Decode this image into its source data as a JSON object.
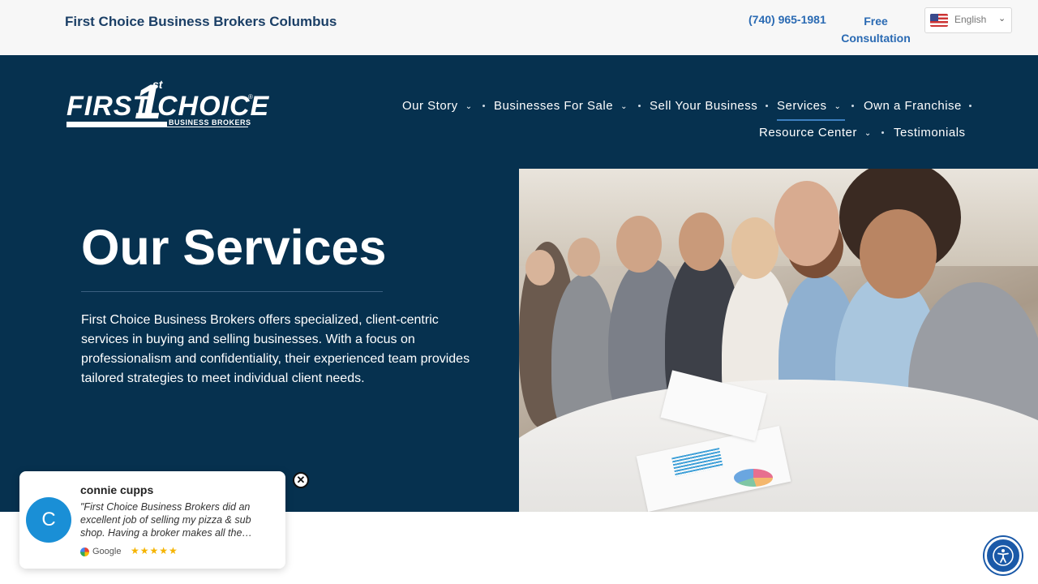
{
  "topbar": {
    "site_title": "First Choice Business Brokers Columbus",
    "phone": "(740) 965-1981",
    "consult_line1": "Free",
    "consult_line2": "Consultation",
    "language": "English"
  },
  "logo": {
    "word1": "FIRST",
    "numeral": "1",
    "superscript": "st",
    "word2": "CHOICE",
    "registered": "®",
    "subtitle": "BUSINESS BROKERS"
  },
  "nav": {
    "items": [
      {
        "label": "Our Story",
        "has_dropdown": true
      },
      {
        "label": "Businesses For Sale",
        "has_dropdown": true
      },
      {
        "label": "Sell Your Business",
        "has_dropdown": false
      },
      {
        "label": "Services",
        "has_dropdown": true,
        "active": true
      },
      {
        "label": "Own a Franchise",
        "has_dropdown": false
      },
      {
        "label": "Resource Center",
        "has_dropdown": true
      },
      {
        "label": "Testimonials",
        "has_dropdown": false
      }
    ],
    "chevron": "⌄"
  },
  "hero": {
    "title": "Our Services",
    "text": "First Choice Business Brokers offers specialized, client-centric services in buying and selling businesses. With a focus on professionalism and confidentiality, their experienced team provides tailored strategies to meet individual client needs."
  },
  "review": {
    "initial": "C",
    "name": "connie cupps",
    "text": "\"First Choice Business Brokers did an excellent job of selling my pizza & sub shop. Having a broker makes all the…",
    "source": "Google",
    "stars": "★★★★★",
    "rating": 5,
    "close": "✕"
  },
  "colors": {
    "navy": "#06314f",
    "link_blue": "#2a6ab3",
    "avatar_blue": "#1a8fd6",
    "star_gold": "#f5b400"
  },
  "icons": {
    "flag": "us-flag-icon",
    "accessibility": "accessibility-icon",
    "google": "google-icon"
  }
}
